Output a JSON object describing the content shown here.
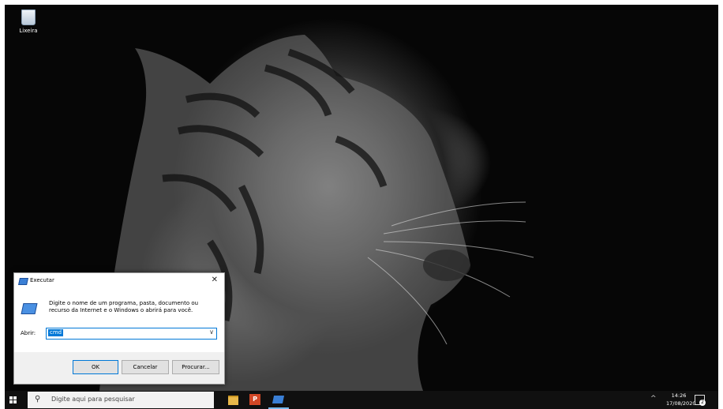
{
  "desktop": {
    "recycle_bin_label": "Lixeira"
  },
  "run_dialog": {
    "title": "Executar",
    "close_label": "✕",
    "description": "Digite o nome de um programa, pasta, documento ou recurso da Internet e o Windows o abrirá para você.",
    "open_label": "Abrir:",
    "input_value": "cmd",
    "dropdown_icon": "∨",
    "ok_label": "OK",
    "cancel_label": "Cancelar",
    "browse_label": "Procurar..."
  },
  "taskbar": {
    "search_placeholder": "Digite aqui para pesquisar",
    "search_icon": "⚲",
    "powerpoint_letter": "P",
    "tray_chevron": "^",
    "time": "14:26",
    "date": "17/08/2020",
    "notification_count": "2"
  }
}
